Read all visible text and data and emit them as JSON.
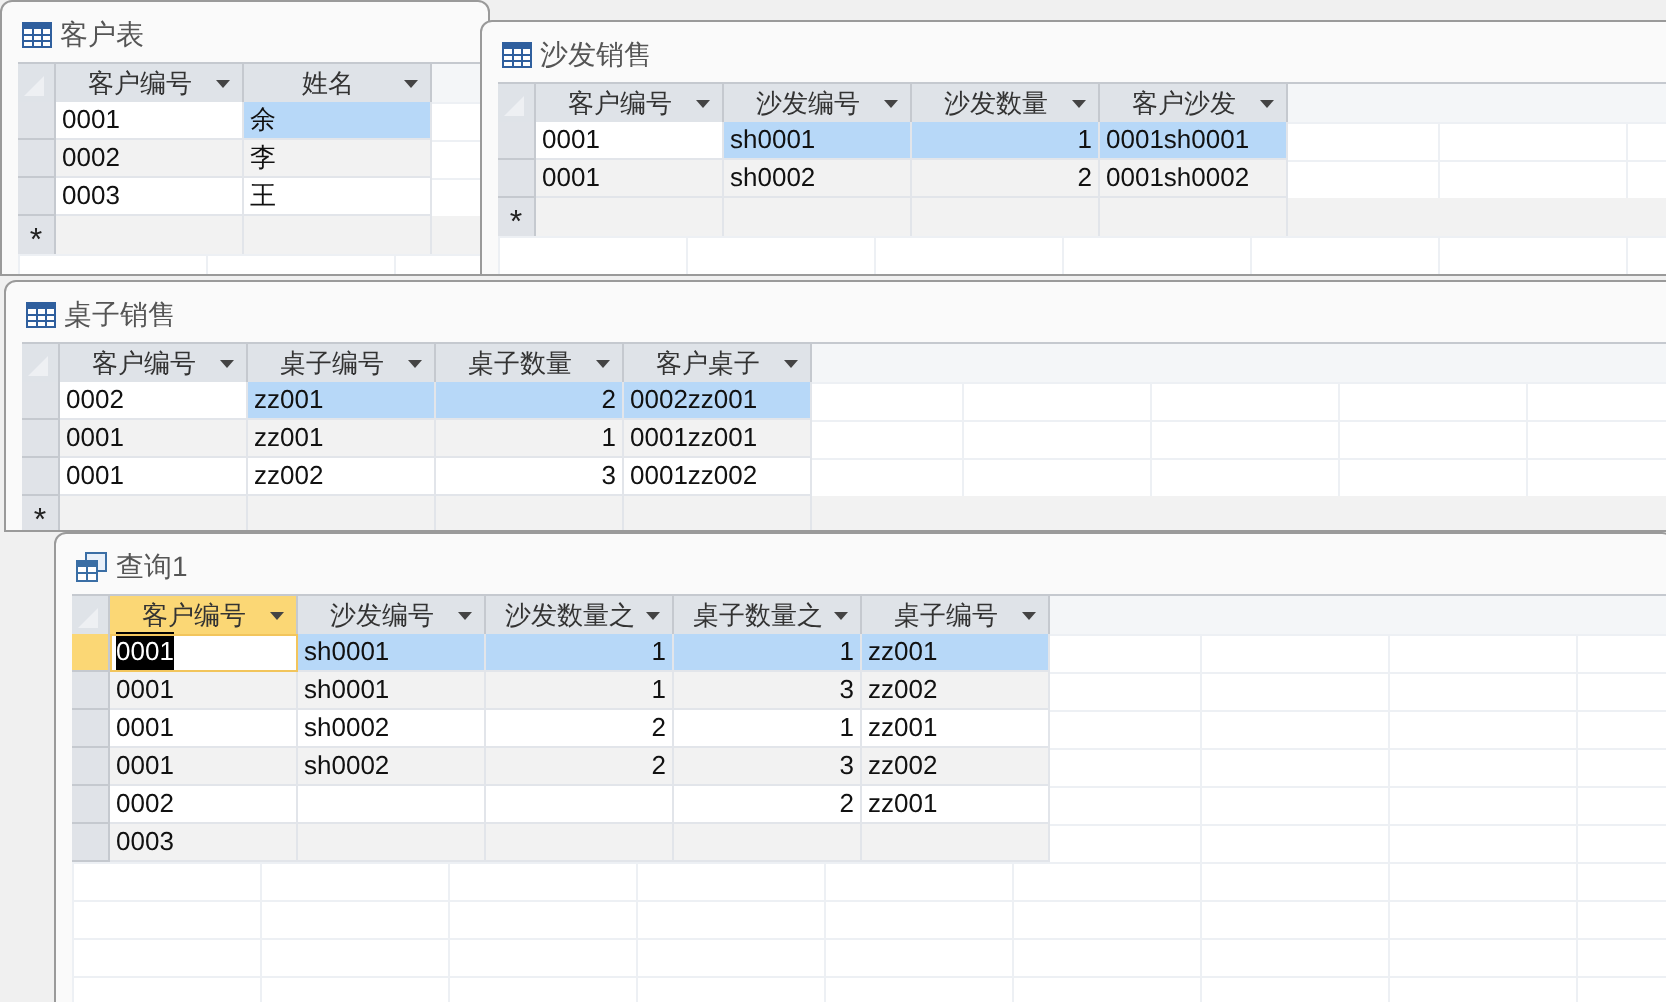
{
  "windows": [
    {
      "title": "客户表",
      "kind": "table",
      "new_row": "*",
      "columns": [
        {
          "label": "客户编号",
          "kind": "text",
          "active": false
        },
        {
          "label": "姓名",
          "kind": "text",
          "active": false
        }
      ],
      "rows": [
        {
          "cells": [
            "0001",
            "余"
          ],
          "selected": true
        },
        {
          "cells": [
            "0002",
            "李"
          ],
          "selected": false
        },
        {
          "cells": [
            "0003",
            "王"
          ],
          "selected": false
        }
      ]
    },
    {
      "title": "沙发销售",
      "kind": "table",
      "new_row": "*",
      "columns": [
        {
          "label": "客户编号",
          "kind": "text",
          "active": false
        },
        {
          "label": "沙发编号",
          "kind": "text",
          "active": false
        },
        {
          "label": "沙发数量",
          "kind": "number",
          "active": false
        },
        {
          "label": "客户沙发",
          "kind": "text",
          "active": false
        }
      ],
      "rows": [
        {
          "cells": [
            "0001",
            "sh0001",
            "1",
            "0001sh0001"
          ],
          "selected": true
        },
        {
          "cells": [
            "0001",
            "sh0002",
            "2",
            "0001sh0002"
          ],
          "selected": false
        }
      ]
    },
    {
      "title": "桌子销售",
      "kind": "table",
      "new_row": "*",
      "columns": [
        {
          "label": "客户编号",
          "kind": "text",
          "active": false
        },
        {
          "label": "桌子编号",
          "kind": "text",
          "active": false
        },
        {
          "label": "桌子数量",
          "kind": "number",
          "active": false
        },
        {
          "label": "客户桌子",
          "kind": "text",
          "active": false
        }
      ],
      "rows": [
        {
          "cells": [
            "0002",
            "zz001",
            "2",
            "0002zz001"
          ],
          "selected": true
        },
        {
          "cells": [
            "0001",
            "zz001",
            "1",
            "0001zz001"
          ],
          "selected": false
        },
        {
          "cells": [
            "0001",
            "zz002",
            "3",
            "0001zz002"
          ],
          "selected": false
        }
      ]
    },
    {
      "title": "查询1",
      "kind": "query",
      "columns": [
        {
          "label": "客户编号",
          "kind": "text",
          "active": true
        },
        {
          "label": "沙发编号",
          "kind": "text",
          "active": false
        },
        {
          "label": "沙发数量之",
          "kind": "number",
          "active": false
        },
        {
          "label": "桌子数量之",
          "kind": "number",
          "active": false
        },
        {
          "label": "桌子编号",
          "kind": "text",
          "active": false
        }
      ],
      "rows": [
        {
          "cells": [
            "0001",
            "sh0001",
            "1",
            "1",
            "zz001"
          ],
          "selected": true
        },
        {
          "cells": [
            "0001",
            "sh0001",
            "1",
            "3",
            "zz002"
          ],
          "selected": false
        },
        {
          "cells": [
            "0001",
            "sh0002",
            "2",
            "1",
            "zz001"
          ],
          "selected": false
        },
        {
          "cells": [
            "0001",
            "sh0002",
            "2",
            "3",
            "zz002"
          ],
          "selected": false
        },
        {
          "cells": [
            "0002",
            "",
            "",
            "2",
            "zz001"
          ],
          "selected": false
        },
        {
          "cells": [
            "0003",
            "",
            "",
            "",
            ""
          ],
          "selected": false
        }
      ]
    }
  ]
}
